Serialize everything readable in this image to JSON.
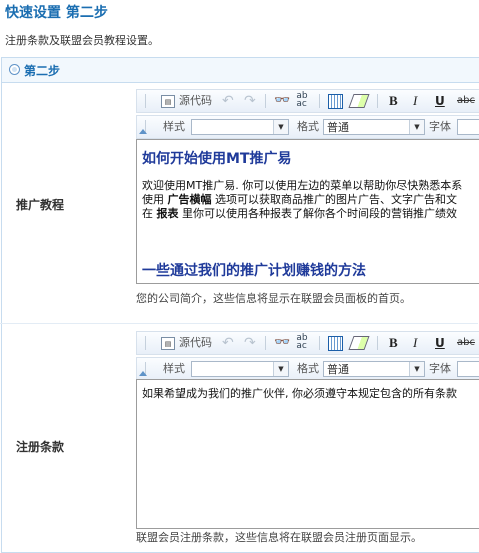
{
  "page": {
    "title": "快速设置 第二步",
    "description": "注册条款及联盟会员教程设置。"
  },
  "panel": {
    "title": "第二步"
  },
  "toolbar": {
    "source_label": "源代码",
    "style_label": "样式",
    "format_label": "格式",
    "format_value": "普通",
    "font_label": "字体",
    "bold": "B",
    "italic": "I",
    "strike": "abc"
  },
  "tutorial": {
    "label": "推广教程",
    "heading": "如何开始使用MT推广易",
    "line1": "欢迎使用MT推广易. 你可以使用左边的菜单以帮助你尽快熟悉本系",
    "line2_a": "使用 ",
    "line2_b": "广告横幅",
    "line2_c": " 选项可以获取商品推广的图片广告、文字广告和文",
    "line3_a": "在 ",
    "line3_b": "报表",
    "line3_c": " 里你可以使用各种报表了解你各个时间段的营销推广绩效",
    "heading2": "一些通过我们的推广计划赚钱的方法",
    "note": "您的公司简介，这些信息将显示在联盟会员面板的首页。"
  },
  "terms": {
    "label": "注册条款",
    "line1": "如果希望成为我们的推广伙伴, 你必须遵守本规定包含的所有条款",
    "note": "联盟会员注册条款，这些信息将在联盟会员注册页面显示。"
  }
}
